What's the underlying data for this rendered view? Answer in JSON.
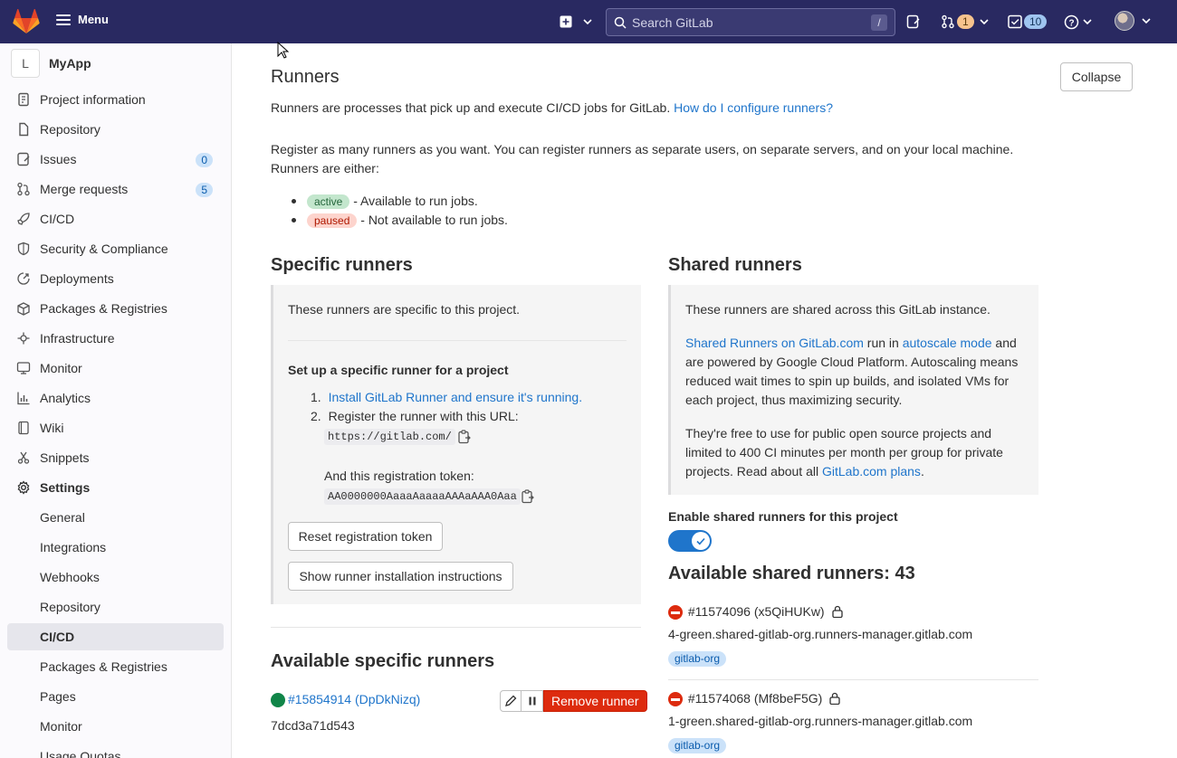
{
  "topbar": {
    "menu_label": "Menu",
    "search_placeholder": "Search GitLab",
    "search_shortcut": "/",
    "merge_requests_count": "1",
    "todos_count": "10"
  },
  "sidebar": {
    "project_initial": "L",
    "project_name": "MyApp",
    "items": [
      {
        "label": "Project information",
        "icon": "info-icon"
      },
      {
        "label": "Repository",
        "icon": "doc-icon"
      },
      {
        "label": "Issues",
        "icon": "issues-icon",
        "count": "0"
      },
      {
        "label": "Merge requests",
        "icon": "merge-icon",
        "count": "5"
      },
      {
        "label": "CI/CD",
        "icon": "rocket-icon"
      },
      {
        "label": "Security & Compliance",
        "icon": "shield-icon"
      },
      {
        "label": "Deployments",
        "icon": "deploy-icon"
      },
      {
        "label": "Packages & Registries",
        "icon": "package-icon"
      },
      {
        "label": "Infrastructure",
        "icon": "cloud-icon"
      },
      {
        "label": "Monitor",
        "icon": "monitor-icon"
      },
      {
        "label": "Analytics",
        "icon": "chart-icon"
      },
      {
        "label": "Wiki",
        "icon": "book-icon"
      },
      {
        "label": "Snippets",
        "icon": "scissors-icon"
      },
      {
        "label": "Settings",
        "icon": "gear-icon"
      }
    ],
    "settings_sub": [
      "General",
      "Integrations",
      "Webhooks",
      "Repository",
      "CI/CD",
      "Packages & Registries",
      "Pages",
      "Monitor",
      "Usage Quotas"
    ]
  },
  "runners": {
    "title": "Runners",
    "collapse_label": "Collapse",
    "intro": "Runners are processes that pick up and execute CI/CD jobs for GitLab.",
    "intro_link": "How do I configure runners?",
    "register_line1": "Register as many runners as you want. You can register runners as separate users, on separate servers, and on your local machine.",
    "register_line2": "Runners are either:",
    "active_badge": "active",
    "active_desc": "- Available to run jobs.",
    "paused_badge": "paused",
    "paused_desc": "- Not available to run jobs."
  },
  "specific": {
    "title": "Specific runners",
    "desc": "These runners are specific to this project.",
    "setup_title": "Set up a specific runner for a project",
    "step1_num": "1.",
    "step1_link": "Install GitLab Runner and ensure it's running.",
    "step2_num": "2.",
    "step2_text": "Register the runner with this URL:",
    "url": "https://gitlab.com/",
    "token_label": "And this registration token:",
    "token": "AA0000000AaaaAaaaaAAAaAAA0Aaa",
    "reset_btn": "Reset registration token",
    "show_btn": "Show runner installation instructions",
    "available_title": "Available specific runners",
    "runner_id": "#15854914 (DpDkNizq)",
    "runner_hash": "7dcd3a71d543",
    "remove_btn": "Remove runner"
  },
  "shared": {
    "title": "Shared runners",
    "desc": "These runners are shared across this GitLab instance.",
    "p1_link1": "Shared Runners on GitLab.com",
    "p1_text1": " run in ",
    "p1_link2": "autoscale mode",
    "p1_text2": " and",
    "p1_line2": "are powered by Google Cloud Platform. Autoscaling means",
    "p1_line3": "reduced wait times to spin up builds, and isolated VMs for",
    "p1_line4": "each project, thus maximizing security.",
    "p2_line1": "They're free to use for public open source projects and",
    "p2_line2": "limited to 400 CI minutes per month per group for private",
    "p2_line3": "projects. Read about all ",
    "p2_link": "GitLab.com plans",
    "p2_end": ".",
    "enable_label": "Enable shared runners for this project",
    "toggle_on": true,
    "available_title": "Available shared runners: 43",
    "runners": [
      {
        "id": "#11574096 (x5QiHUKw)",
        "host": "4-green.shared-gitlab-org.runners-manager.gitlab.com",
        "tag": "gitlab-org"
      },
      {
        "id": "#11574068 (Mf8beF5G)",
        "host": "1-green.shared-gitlab-org.runners-manager.gitlab.com",
        "tag": "gitlab-org"
      }
    ]
  }
}
